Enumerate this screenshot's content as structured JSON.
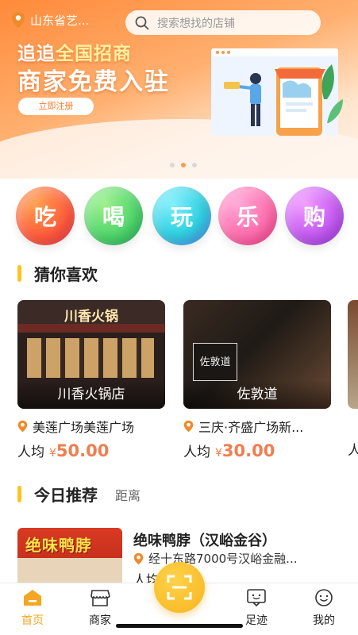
{
  "header": {
    "location": "山东省艺...",
    "search_placeholder": "搜索想找的店铺"
  },
  "banner": {
    "line1_prefix": "追追",
    "line1_highlight": "全国招商",
    "line2": "商家免费入驻",
    "button": "立即注册"
  },
  "categories": [
    "吃",
    "喝",
    "玩",
    "乐",
    "购"
  ],
  "guess": {
    "title": "猜你喜欢",
    "cards": [
      {
        "caption": "川香火锅店",
        "sign": "川香火锅",
        "address": "美莲广场美莲广场",
        "price_label": "人均",
        "currency": "¥",
        "price": "50.00"
      },
      {
        "caption": "佐敦道",
        "sign": "佐敦道",
        "address": "三庆·齐盛广场新...",
        "price_label": "人均",
        "currency": "¥",
        "price": "30.00"
      },
      {
        "caption": "",
        "sign": "",
        "address": "",
        "price_label": "人",
        "currency": "",
        "price": ""
      }
    ]
  },
  "today": {
    "title": "今日推荐",
    "subtitle": "距离",
    "item": {
      "thumb_text": "绝味鸭脖",
      "name": "绝味鸭脖（汉峪金谷）",
      "address": "经十东路7000号汉峪金融...",
      "price_label": "人均"
    }
  },
  "nav": [
    {
      "label": "首页",
      "icon": "home-icon"
    },
    {
      "label": "商家",
      "icon": "shop-icon"
    },
    {
      "label": "",
      "icon": "scan-icon"
    },
    {
      "label": "足迹",
      "icon": "footprint-icon"
    },
    {
      "label": "我的",
      "icon": "profile-icon"
    }
  ],
  "colors": {
    "accent": "#f5a623",
    "price": "#f07e4e",
    "section_bar": "#ffc21e"
  }
}
